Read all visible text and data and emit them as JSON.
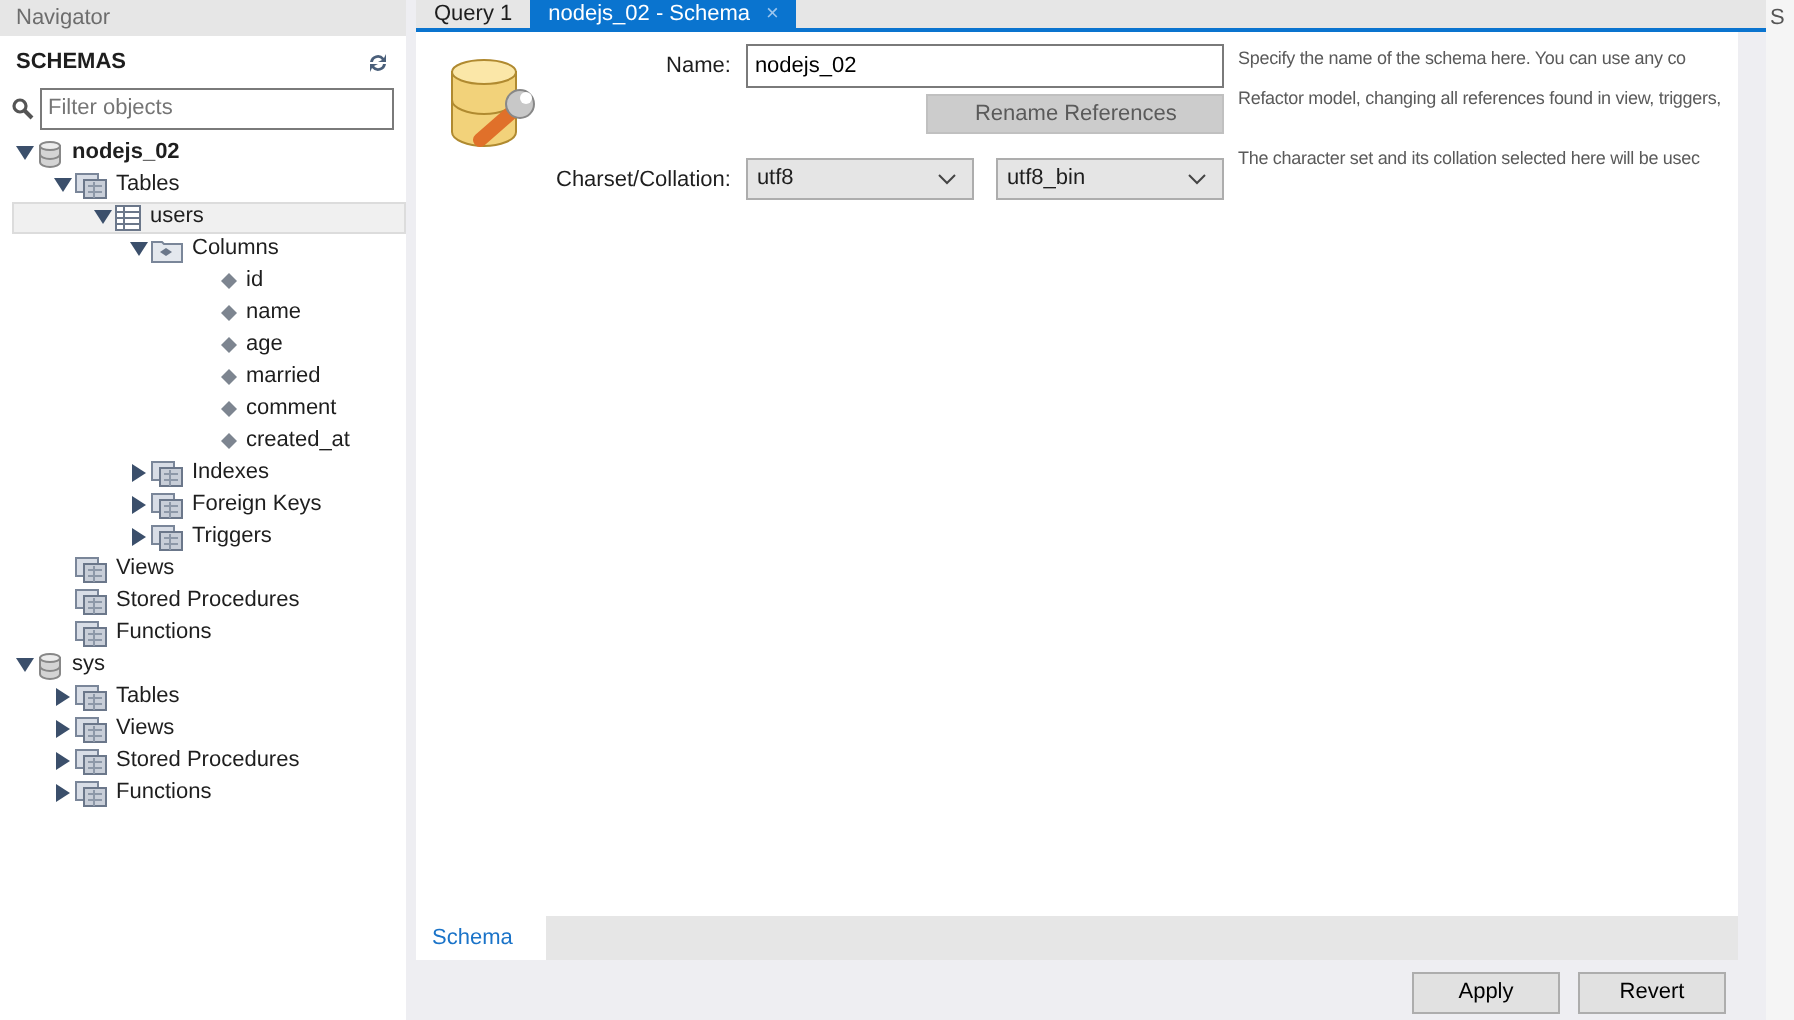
{
  "navigator": {
    "title": "Navigator",
    "section": "SCHEMAS",
    "filter": {
      "placeholder": "Filter objects"
    },
    "tree": [
      {
        "label": "nodejs_02",
        "kind": "schema",
        "expanded": true,
        "selected": false,
        "children": [
          {
            "label": "Tables",
            "kind": "folder",
            "expanded": true,
            "selected": false,
            "children": [
              {
                "label": "users",
                "kind": "table",
                "expanded": true,
                "selected": true,
                "children": [
                  {
                    "label": "Columns",
                    "kind": "columns",
                    "expanded": true,
                    "selected": false,
                    "children": [
                      {
                        "label": "id",
                        "kind": "column",
                        "selected": false
                      },
                      {
                        "label": "name",
                        "kind": "column",
                        "selected": false
                      },
                      {
                        "label": "age",
                        "kind": "column",
                        "selected": false
                      },
                      {
                        "label": "married",
                        "kind": "column",
                        "selected": false
                      },
                      {
                        "label": "comment",
                        "kind": "column",
                        "selected": false
                      },
                      {
                        "label": "created_at",
                        "kind": "column",
                        "selected": false
                      }
                    ]
                  },
                  {
                    "label": "Indexes",
                    "kind": "folder",
                    "expanded": false,
                    "selected": false
                  },
                  {
                    "label": "Foreign Keys",
                    "kind": "folder",
                    "expanded": false,
                    "selected": false
                  },
                  {
                    "label": "Triggers",
                    "kind": "folder",
                    "expanded": false,
                    "selected": false
                  }
                ]
              }
            ]
          },
          {
            "label": "Views",
            "kind": "folder",
            "selected": false
          },
          {
            "label": "Stored Procedures",
            "kind": "folder",
            "selected": false
          },
          {
            "label": "Functions",
            "kind": "folder",
            "selected": false
          }
        ]
      },
      {
        "label": "sys",
        "kind": "schema",
        "expanded": true,
        "selected": false,
        "children": [
          {
            "label": "Tables",
            "kind": "folder",
            "expanded": false,
            "selected": false
          },
          {
            "label": "Views",
            "kind": "folder",
            "expanded": false,
            "selected": false
          },
          {
            "label": "Stored Procedures",
            "kind": "folder",
            "expanded": false,
            "selected": false
          },
          {
            "label": "Functions",
            "kind": "folder",
            "expanded": false,
            "selected": false
          }
        ]
      }
    ]
  },
  "tabs": [
    {
      "label": "Query 1",
      "selected": false
    },
    {
      "label": "nodejs_02 - Schema",
      "selected": true,
      "close": "×"
    }
  ],
  "form": {
    "name_label": "Name:",
    "name_value": "nodejs_02",
    "rename_button": "Rename References",
    "charset_label": "Charset/Collation:",
    "charset": "utf8",
    "collation": "utf8_bin",
    "help": [
      "Specify the name of the schema here. You can use any co",
      "Refactor model, changing all references found in view, triggers,",
      "The character set and its collation selected here will be usec"
    ]
  },
  "bottom_tabs": [
    {
      "label": "Schema",
      "selected": true
    }
  ],
  "buttons": [
    "Apply",
    "Revert"
  ],
  "right_panel_fragment": "S"
}
